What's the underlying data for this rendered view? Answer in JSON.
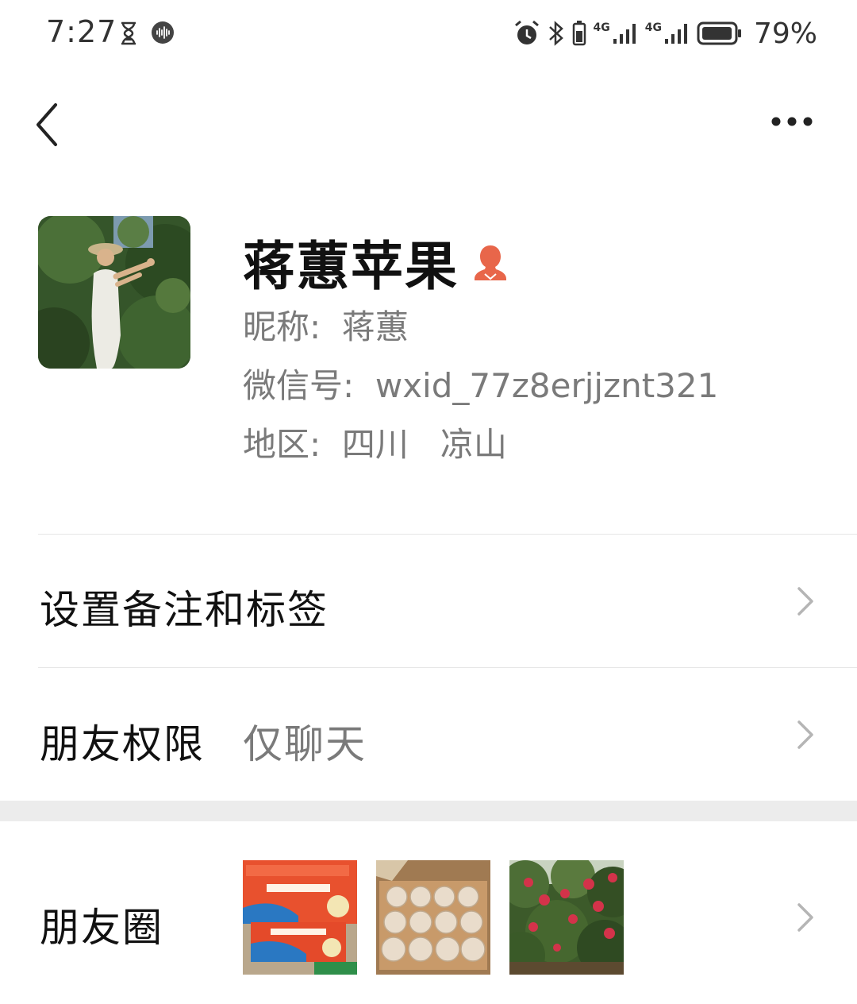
{
  "status_bar": {
    "time": "7:27",
    "battery": "79%",
    "network_1": "4G",
    "network_2": "4G",
    "icons": [
      "hourglass-icon",
      "audio-wave-icon",
      "alarm-icon",
      "bluetooth-icon",
      "battery-icon"
    ]
  },
  "nav": {
    "back_icon": "chevron-left-icon",
    "more_icon": "more-dots-icon"
  },
  "profile": {
    "display_name": "蒋蕙苹果",
    "gender_icon": "female-user-icon",
    "nickname_line": "昵称:  蒋蕙",
    "wechat_id_line": "微信号:  wxid_77z8erjjznt321",
    "region_line": "地区:  四川   凉山"
  },
  "rows": {
    "remark_label": "设置备注和标签",
    "permission_label": "朋友权限",
    "permission_value": "仅聊天",
    "moments_label": "朋友圈"
  },
  "colors": {
    "accent_gender": "#e8664a",
    "secondary_text": "#7a7a7a",
    "divider": "#e6e6e6",
    "section_gap": "#ececec"
  }
}
